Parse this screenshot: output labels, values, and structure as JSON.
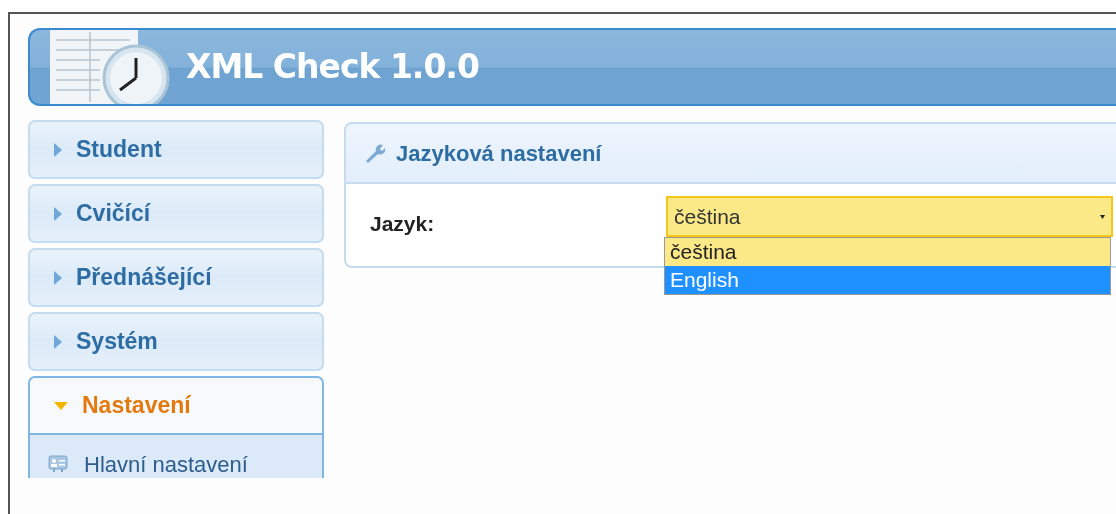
{
  "header": {
    "title": "XML Check 1.0.0"
  },
  "sidebar": {
    "items": [
      {
        "label": "Student",
        "expanded": false
      },
      {
        "label": "Cvičící",
        "expanded": false
      },
      {
        "label": "Přednášející",
        "expanded": false
      },
      {
        "label": "Systém",
        "expanded": false
      },
      {
        "label": "Nastavení",
        "expanded": true,
        "children": [
          {
            "label": "Hlavní nastavení"
          }
        ]
      }
    ]
  },
  "panel": {
    "title": "Jazyková nastavení",
    "field": {
      "label": "Jazyk:",
      "value": "čeština",
      "open": true,
      "options": [
        {
          "label": "čeština",
          "highlighted": false
        },
        {
          "label": "English",
          "highlighted": true
        }
      ]
    }
  }
}
